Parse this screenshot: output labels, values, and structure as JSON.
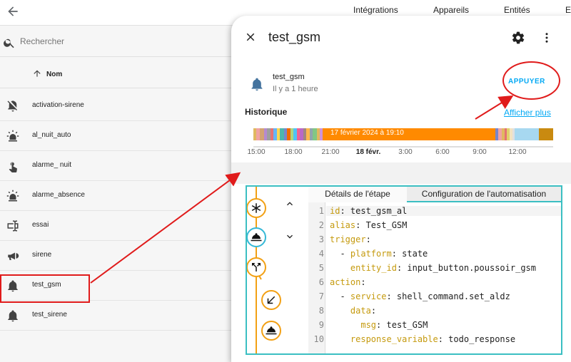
{
  "topbar": {
    "tabs": [
      "Intégrations",
      "Appareils",
      "Entités",
      "E"
    ]
  },
  "sidebar": {
    "search_placeholder": "Rechercher",
    "column_header": "Nom",
    "items": [
      {
        "label": "activation-sirene",
        "icon": "bell-off-icon"
      },
      {
        "label": "al_nuit_auto",
        "icon": "alarm-light-icon"
      },
      {
        "label": "alarme_ nuit",
        "icon": "gesture-tap-icon"
      },
      {
        "label": "alarme_absence",
        "icon": "alarm-light-icon"
      },
      {
        "label": "essai",
        "icon": "form-textbox-icon"
      },
      {
        "label": "sirene",
        "icon": "bullhorn-icon"
      },
      {
        "label": "test_gsm",
        "icon": "bell-icon"
      },
      {
        "label": "test_sirene",
        "icon": "bell-icon"
      }
    ]
  },
  "dialog": {
    "title": "test_gsm",
    "entity_name": "test_gsm",
    "entity_state": "Il y a 1 heure",
    "press_button": "APPUYER",
    "history_title": "Historique",
    "show_more": "Afficher plus",
    "timeline_label": "17 février 2024 à 19:10",
    "time_ticks": [
      "15:00",
      "18:00",
      "21:00",
      "18 févr.",
      "3:00",
      "6:00",
      "9:00",
      "12:00"
    ],
    "timeline_colors": {
      "primary": "#ff8a00",
      "tail": "#c98a10",
      "light": "#a7d8f0"
    }
  },
  "trace": {
    "tab_steps": "Détails de l'étape",
    "tab_config": "Configuration de l'automatisation",
    "node_icons": [
      "asterisk-icon",
      "room-service-icon",
      "call-split-icon",
      "arrow-bottom-left-icon",
      "room-service-icon"
    ],
    "code_lines": [
      {
        "n": "1",
        "key": "id",
        "rest": ": test_gsm_al"
      },
      {
        "n": "2",
        "key": "alias",
        "rest": ": Test_GSM"
      },
      {
        "n": "3",
        "key": "trigger",
        "rest": ":"
      },
      {
        "n": "4",
        "pre": "  - ",
        "key": "platform",
        "rest": ": state"
      },
      {
        "n": "5",
        "pre": "    ",
        "key": "entity_id",
        "rest": ": input_button.poussoir_gsm"
      },
      {
        "n": "6",
        "key": "action",
        "rest": ":"
      },
      {
        "n": "7",
        "pre": "  - ",
        "key": "service",
        "rest": ": shell_command.set_aldz"
      },
      {
        "n": "8",
        "pre": "    ",
        "key": "data",
        "rest": ":"
      },
      {
        "n": "9",
        "pre": "      ",
        "key": "msg",
        "rest": ": test_GSM"
      },
      {
        "n": "10",
        "pre": "    ",
        "key": "response_variable",
        "rest": ": todo_response"
      }
    ]
  },
  "colors": {
    "accent": "#03a9f4",
    "annotation_red": "#e01b1b",
    "trace_border": "#3bbfc2",
    "node_orange": "#f2a014",
    "node_active": "#35b8d6",
    "yaml_key": "#c59a0e"
  }
}
